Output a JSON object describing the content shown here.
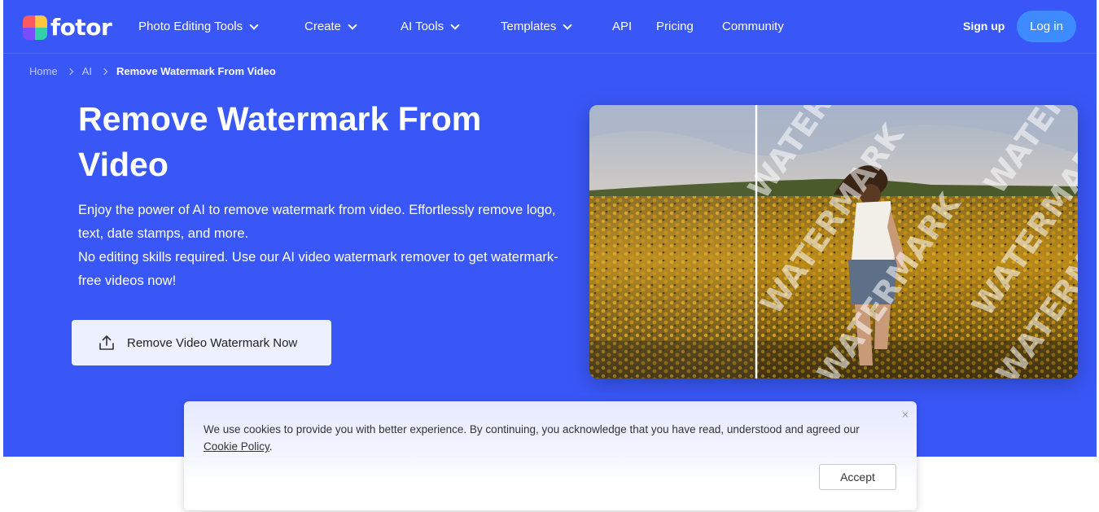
{
  "nav": {
    "logo_text": "fotor",
    "items": [
      {
        "label": "Photo Editing Tools",
        "has_dropdown": true
      },
      {
        "label": "Create",
        "has_dropdown": true
      },
      {
        "label": "AI Tools",
        "has_dropdown": true
      },
      {
        "label": "Templates",
        "has_dropdown": true
      },
      {
        "label": "API",
        "has_dropdown": false
      },
      {
        "label": "Pricing",
        "has_dropdown": false
      },
      {
        "label": "Community",
        "has_dropdown": false
      }
    ],
    "signup": "Sign up",
    "login": "Log in"
  },
  "breadcrumb": [
    "Home",
    "AI",
    "Remove Watermark From Video"
  ],
  "hero": {
    "title": "Remove Watermark From Video",
    "desc_line1": "Enjoy the power of AI to remove watermark from video. Effortlessly remove logo, text, date stamps, and more.",
    "desc_line2": "No editing skills required. Use our AI video watermark remover to get watermark-free videos now!",
    "cta": "Remove Video Watermark Now",
    "watermark_word": "WATERMARK"
  },
  "cookie": {
    "text_before": "We use cookies to provide you with better experience. By continuing, you acknowledge that you have read, understood and agreed our ",
    "link": "Cookie Policy",
    "text_after": ".",
    "close": "×",
    "accept": "Accept"
  },
  "colors": {
    "hero_bg": "#3957f7",
    "login_bg": "#3d8bff"
  }
}
